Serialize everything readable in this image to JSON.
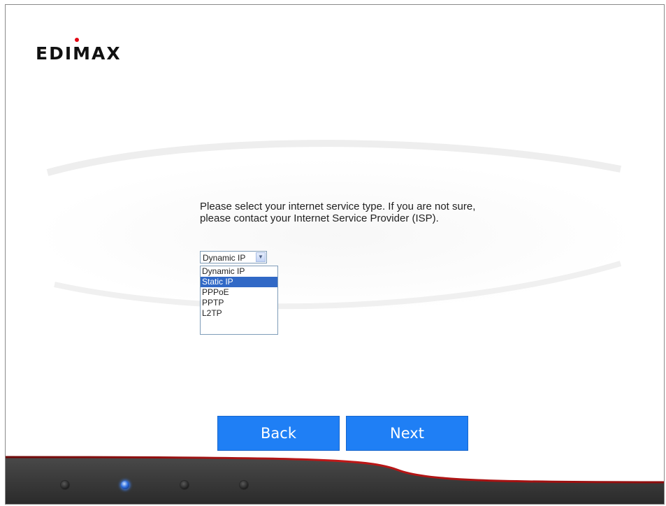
{
  "brand": {
    "logo_text": "EDIMAX",
    "accent_color": "#e30613"
  },
  "wizard": {
    "prompt": "Please select your internet service type. If you are not sure, please contact your Internet Service Provider (ISP).",
    "select": {
      "selected": "Dynamic IP",
      "options": [
        "Dynamic IP",
        "Static IP",
        "PPPoE",
        "PPTP",
        "L2TP"
      ],
      "highlighted": "Static IP"
    },
    "buttons": {
      "back": "Back",
      "next": "Next"
    },
    "button_color": "#1f7ff5"
  },
  "progress": {
    "total_steps": 4,
    "current_step": 2
  }
}
